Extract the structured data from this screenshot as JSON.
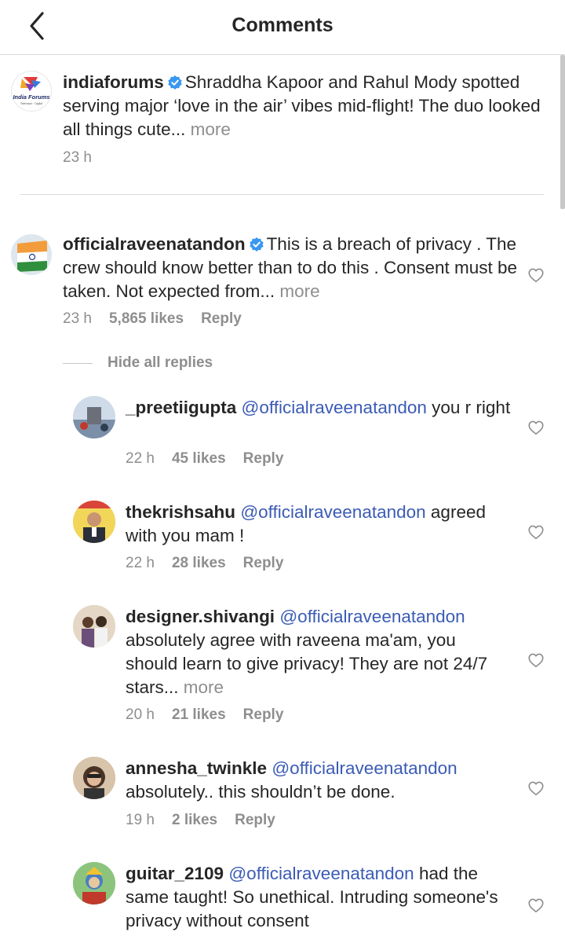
{
  "header": {
    "title": "Comments"
  },
  "caption": {
    "username": "indiaforums",
    "avatar_lines": [
      "India Forums",
      "Television · Digital"
    ],
    "text": "Shraddha Kapoor and Rahul Mody spotted serving major ‘love in the air’ vibes mid-flight! The duo looked all things cute...",
    "more": "more",
    "time": "23 h"
  },
  "comment": {
    "username": "officialraveenatandon",
    "text": "This is a breach of privacy . The crew should know better than to do this . Consent must be taken. Not expected from...",
    "more": "more",
    "time": "23 h",
    "likes": "5,865 likes",
    "reply": "Reply",
    "hide_replies": "Hide all replies"
  },
  "replies": [
    {
      "username": "_preetiigupta",
      "mention": "@officialraveenatandon",
      "text": "you r right",
      "more": "",
      "time": "22 h",
      "likes": "45 likes",
      "reply": "Reply"
    },
    {
      "username": "thekrishsahu",
      "mention": "@officialraveenatandon",
      "text": "agreed with you mam !",
      "more": "",
      "time": "22 h",
      "likes": "28 likes",
      "reply": "Reply"
    },
    {
      "username": "designer.shivangi",
      "mention": "@officialraveenatandon",
      "text": "absolutely agree with raveena ma'am, you should learn to give privacy! They are not 24/7 stars...",
      "more": "more",
      "time": "20 h",
      "likes": "21 likes",
      "reply": "Reply"
    },
    {
      "username": "annesha_twinkle",
      "mention": "@officialraveenatandon",
      "text": "absolutely.. this shouldn’t be done.",
      "more": "",
      "time": "19 h",
      "likes": "2 likes",
      "reply": "Reply"
    },
    {
      "username": "guitar_2109",
      "mention": "@officialraveenatandon",
      "text": "had the same taught! So unethical. Intruding someone's privacy without consent",
      "more": "",
      "time": "",
      "likes": "",
      "reply": ""
    }
  ],
  "colors": {
    "mention": "#3b5bb5",
    "verified": "#3897f0",
    "secondary_text": "#8e8e8e"
  }
}
